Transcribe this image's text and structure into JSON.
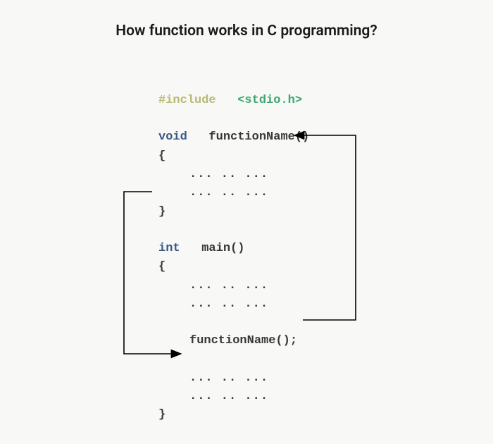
{
  "title": "How function works in C programming?",
  "code": {
    "include_directive": "#include",
    "header": "<stdio.h>",
    "void_kw": "void",
    "fn_decl": "functionName()",
    "open_brace": "{",
    "close_brace": "}",
    "dots1": "... .. ...",
    "dots2": "... .. ...",
    "int_kw": "int",
    "main_decl": "main()",
    "dots3": "... .. ...",
    "dots4": "... .. ...",
    "fn_call": "functionName();",
    "dots5": "... .. ...",
    "dots6": "... .. ..."
  },
  "arrows": {
    "call_to_def": "Arrow from functionName(); call up to function definition opening brace",
    "def_to_return": "Arrow from function closing brace down to after the call in main"
  }
}
